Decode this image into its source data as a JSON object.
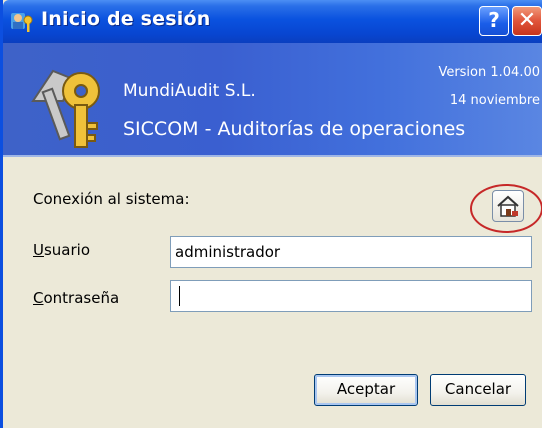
{
  "window": {
    "title": "Inicio de sesión",
    "help_label": "?",
    "close_label": "✕"
  },
  "banner": {
    "company": "MundiAudit S.L.",
    "app_name": "SICCOM - Auditorías de operaciones",
    "version": "Version 1.04.00",
    "date": "14 noviembre"
  },
  "form": {
    "connection_label": "Conexión al sistema:",
    "user_label_first": "U",
    "user_label_rest": "suario",
    "user_value": "administrador",
    "password_label_first": "C",
    "password_label_rest": "ontraseña",
    "password_value": ""
  },
  "buttons": {
    "ok": "Aceptar",
    "cancel": "Cancelar"
  },
  "colors": {
    "titlebar": "#0a52df",
    "banner": "#3e62c8",
    "highlight_ring": "#c62828"
  }
}
